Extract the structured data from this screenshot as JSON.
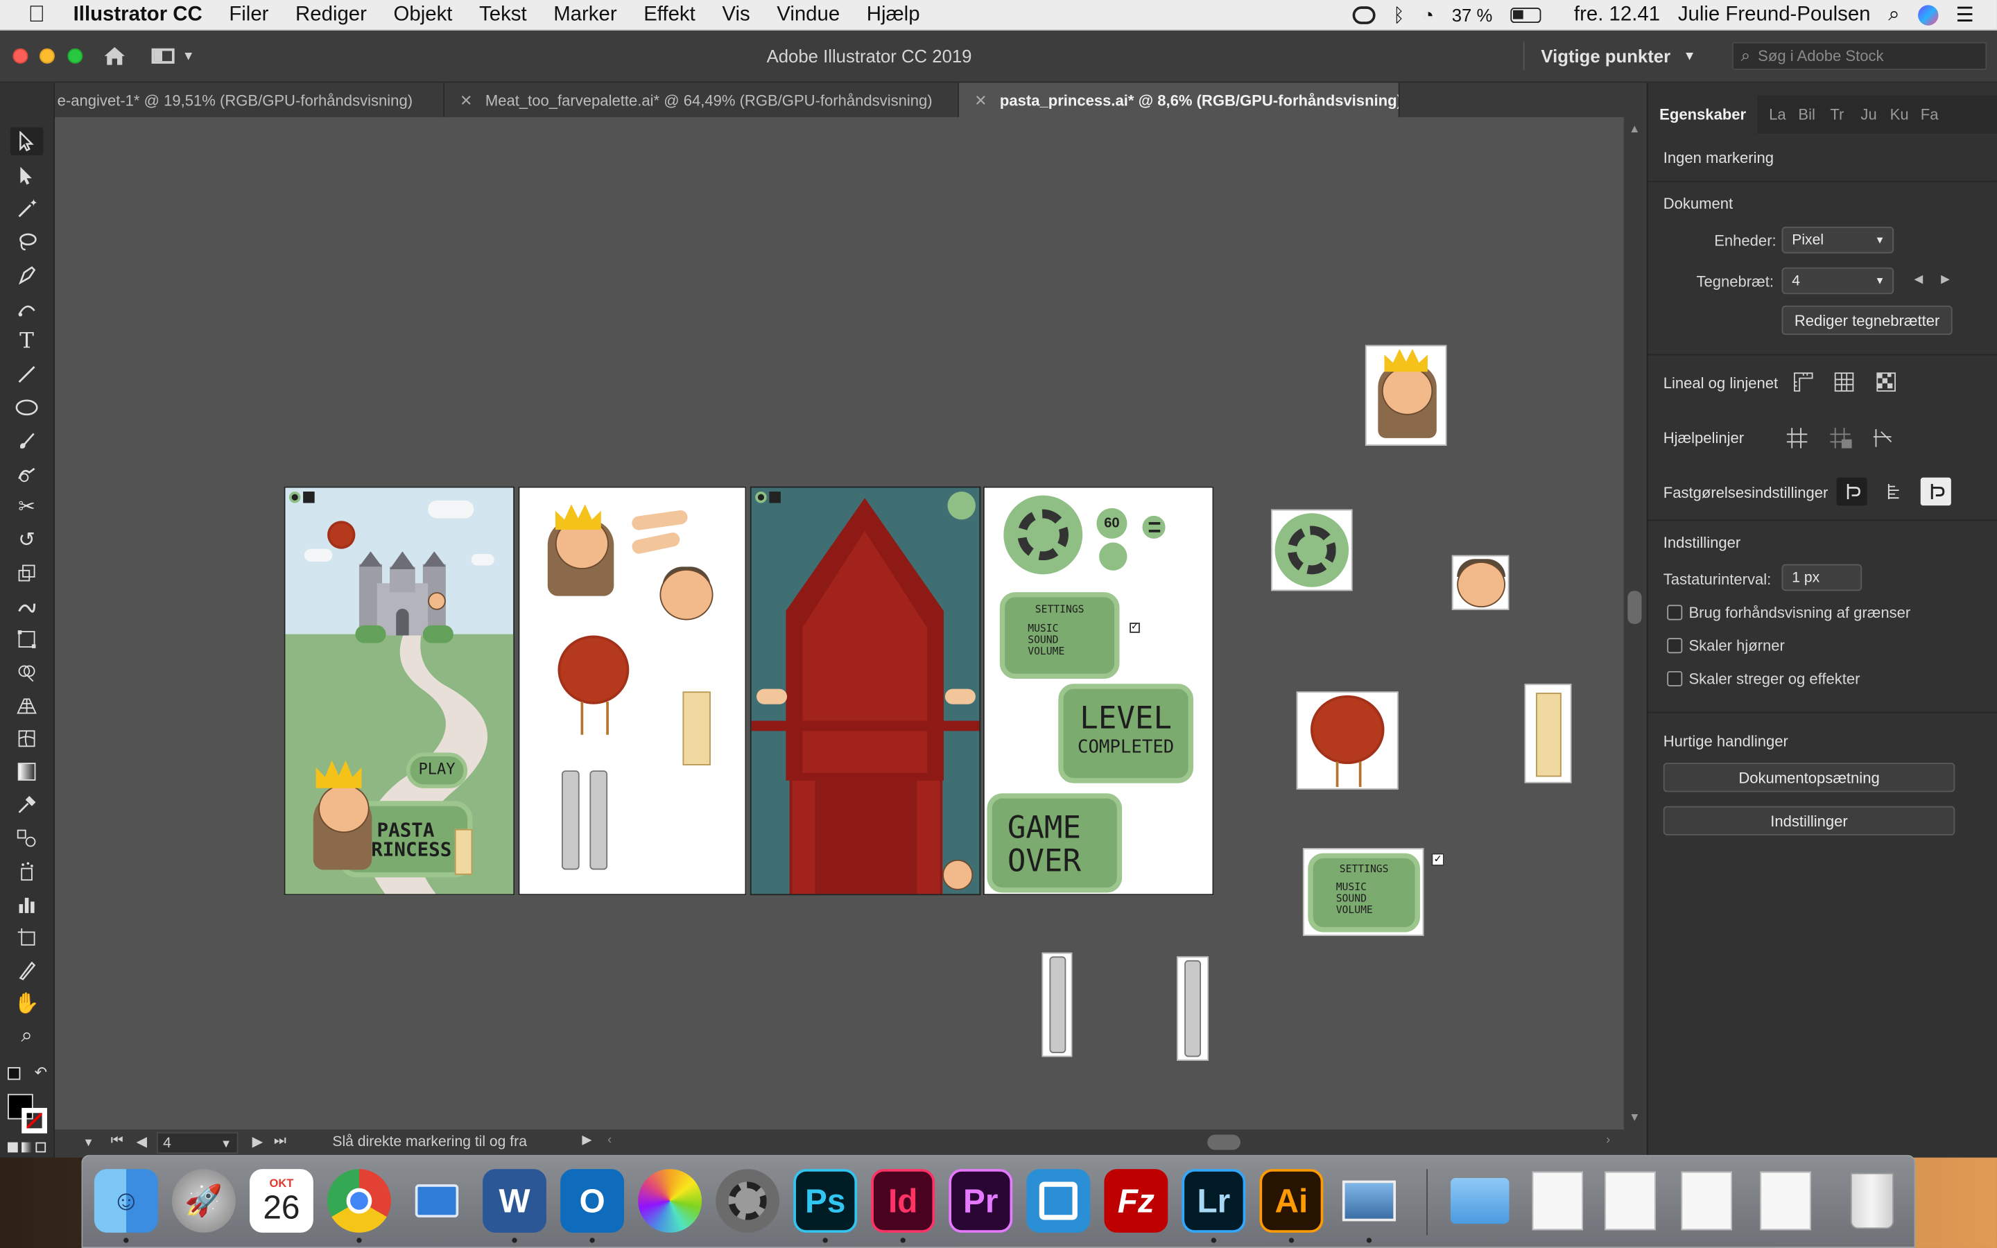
{
  "menubar": {
    "app_name": "Illustrator CC",
    "items": [
      "Filer",
      "Rediger",
      "Objekt",
      "Tekst",
      "Marker",
      "Effekt",
      "Vis",
      "Vindue",
      "Hjælp"
    ],
    "battery": "37 %",
    "clock": "fre. 12.41",
    "user": "Julie Freund-Poulsen"
  },
  "window": {
    "title": "Adobe Illustrator CC 2019",
    "workspace": "Vigtige punkter",
    "stock_search_placeholder": "Søg i Adobe Stock"
  },
  "tabs": [
    {
      "label": "e-angivet-1* @ 19,51% (RGB/GPU-forhåndsvisning)",
      "active": false
    },
    {
      "label": "Meat_too_farvepalette.ai* @ 64,49% (RGB/GPU-forhåndsvisning)",
      "active": false
    },
    {
      "label": "pasta_princess.ai* @ 8,6% (RGB/GPU-forhåndsvisning)",
      "active": true
    }
  ],
  "tools": [
    "selection-tool",
    "direct-selection-tool",
    "magic-wand-tool",
    "lasso-tool",
    "pen-tool",
    "curvature-tool",
    "type-tool",
    "line-tool",
    "ellipse-tool",
    "paintbrush-tool",
    "shaper-tool",
    "scissors-tool",
    "rotate-tool",
    "scale-tool",
    "warp-tool",
    "free-transform-tool",
    "shape-builder-tool",
    "perspective-grid-tool",
    "mesh-tool",
    "gradient-tool",
    "eyedropper-tool",
    "blend-tool",
    "symbol-sprayer-tool",
    "column-graph-tool",
    "artboard-tool",
    "slice-tool",
    "hand-tool",
    "zoom-tool"
  ],
  "artwork": {
    "play": "PLAY",
    "pasta": "PASTA",
    "princess": "PRINCESS",
    "timer": "60",
    "settings": "SETTINGS",
    "music": "MUSIC",
    "sound": "SOUND",
    "volume": "VOLUME",
    "level": "LEVEL",
    "completed": "COMPLETED",
    "game": "GAME",
    "over": "OVER"
  },
  "statusbar": {
    "artboard_value": "4",
    "hint": "Slå direkte markering til og fra"
  },
  "panel": {
    "tabs": [
      "Egenskaber",
      "La",
      "Bil",
      "Tr",
      "Ju",
      "Ku",
      "Fa"
    ],
    "no_selection": "Ingen markering",
    "document_heading": "Dokument",
    "units_label": "Enheder:",
    "units_value": "Pixel",
    "artboard_label": "Tegnebræt:",
    "artboard_value": "4",
    "edit_artboards": "Rediger tegnebrætter",
    "rulers_grids": "Lineal og linjenet",
    "guides": "Hjælpelinjer",
    "snap_options": "Fastgørelsesindstillinger",
    "preferences_heading": "Indstillinger",
    "keyboard_increment_label": "Tastaturinterval:",
    "keyboard_increment_value": "1 px",
    "checkboxes": [
      "Brug forhåndsvisning af grænser",
      "Skaler hjørner",
      "Skaler streger og effekter"
    ],
    "quick_actions": "Hurtige handlinger",
    "document_setup": "Dokumentopsætning",
    "preferences_button": "Indstillinger"
  },
  "dock": {
    "calendar_month": "OKT",
    "calendar_day": "26",
    "apps": [
      "Finder",
      "Launchpad",
      "Kalender",
      "Chrome",
      "Keynote",
      "Word",
      "Outlook",
      "Fotos",
      "Systemindstillinger",
      "Photoshop",
      "InDesign",
      "Premiere",
      "Screen",
      "FileZilla",
      "Lightroom",
      "Illustrator",
      "Preview",
      "Mappe",
      "Dokument",
      "Dokument",
      "Dokument",
      "Dokument",
      "Papirkurv"
    ],
    "labels": {
      "ps": "Ps",
      "id": "Id",
      "pr": "Pr",
      "lr": "Lr",
      "ai": "Ai",
      "fz": "Fz",
      "w": "W",
      "o": "O"
    }
  },
  "colors": {
    "accent_green": "#7cab6f",
    "meatball_red": "#b5391c",
    "castle_sky": "#d3e6ef",
    "throne_teal": "#3f6f73",
    "throne_red": "#8e1a15"
  }
}
